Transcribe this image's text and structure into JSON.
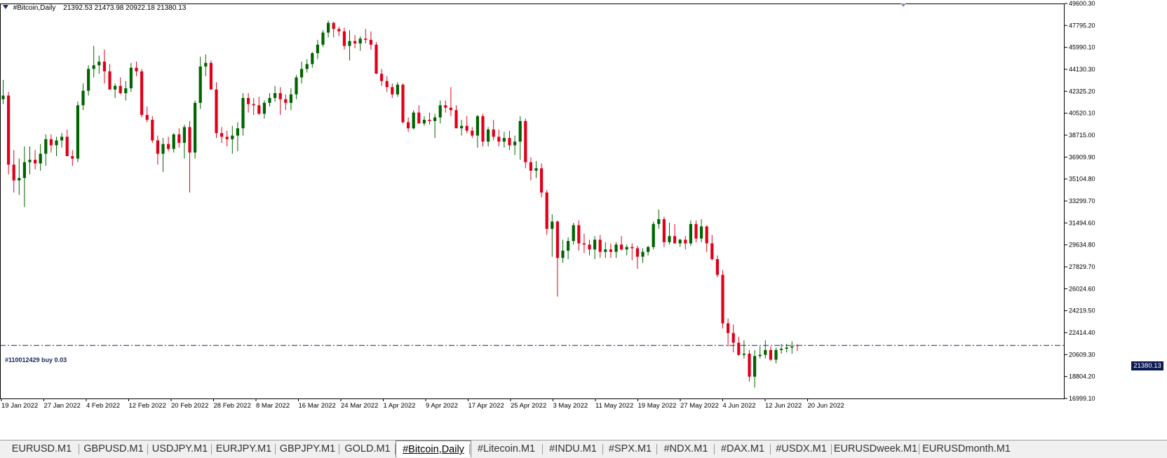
{
  "header": {
    "symbol": "#Bitcoin,Daily",
    "ohlc": "21392.53 21473.98 20922.18 21380.13"
  },
  "order_label": "#110012429 buy 0.03",
  "current_price": "21380.13",
  "colors": {
    "bull": "#006400",
    "bear": "#e0001a",
    "order_line": "#14285a",
    "price_tag": "#0a1a52"
  },
  "tabs": [
    {
      "label": "EURUSD.M1"
    },
    {
      "label": "GBPUSD.M1"
    },
    {
      "label": "USDJPY.M1"
    },
    {
      "label": "EURJPY.M1"
    },
    {
      "label": "GBPJPY.M1"
    },
    {
      "label": "GOLD.M1"
    },
    {
      "label": "#Bitcoin,Daily",
      "active": true
    },
    {
      "label": "#Litecoin.M1"
    },
    {
      "label": "#INDU.M1"
    },
    {
      "label": "#SPX.M1"
    },
    {
      "label": "#NDX.M1"
    },
    {
      "label": "#DAX.M1"
    },
    {
      "label": "#USDX.M1"
    },
    {
      "label": "EURUSDweek.M1"
    },
    {
      "label": "EURUSDmonth.M1"
    }
  ],
  "chart_data": {
    "type": "candlestick",
    "ylim": [
      16999.1,
      49600.3
    ],
    "y_ticks": [
      "49600.30",
      "47795.20",
      "45990.10",
      "44130.30",
      "42325.20",
      "40520.10",
      "38715.00",
      "36909.90",
      "35104.80",
      "33299.70",
      "31494.60",
      "29634.80",
      "27829.70",
      "26024.60",
      "24219.50",
      "22414.40",
      "20609.30",
      "18804.20",
      "16999.10"
    ],
    "x_labels": [
      "19 Jan 2022",
      "27 Jan 2022",
      "4 Feb 2022",
      "12 Feb 2022",
      "20 Feb 2022",
      "28 Feb 2022",
      "8 Mar 2022",
      "16 Mar 2022",
      "24 Mar 2022",
      "1 Apr 2022",
      "9 Apr 2022",
      "17 Apr 2022",
      "25 Apr 2022",
      "3 May 2022",
      "11 May 2022",
      "19 May 2022",
      "27 May 2022",
      "4 Jun 2022",
      "12 Jun 2022",
      "20 Jun 2022"
    ],
    "current_price": 21380.13,
    "series": [
      {
        "name": "#Bitcoin,Daily",
        "candles": [
          [
            41700,
            43300,
            41300,
            42000
          ],
          [
            42000,
            42300,
            35500,
            36300
          ],
          [
            36300,
            37500,
            34000,
            35000
          ],
          [
            35000,
            36800,
            33800,
            35200
          ],
          [
            35200,
            37800,
            32800,
            36500
          ],
          [
            36500,
            37800,
            35500,
            36700
          ],
          [
            36700,
            37500,
            35900,
            36400
          ],
          [
            36400,
            38000,
            35800,
            37200
          ],
          [
            37200,
            38800,
            36200,
            38400
          ],
          [
            38400,
            38800,
            37300,
            37900
          ],
          [
            37900,
            38600,
            37000,
            38300
          ],
          [
            38300,
            38900,
            37700,
            38600
          ],
          [
            38600,
            39200,
            37200,
            37000
          ],
          [
            37000,
            37500,
            36200,
            36800
          ],
          [
            36800,
            41500,
            36500,
            41200
          ],
          [
            41200,
            43000,
            40800,
            42400
          ],
          [
            42400,
            44500,
            42000,
            44200
          ],
          [
            44200,
            46100,
            43500,
            44500
          ],
          [
            44500,
            45300,
            43800,
            44800
          ],
          [
            44800,
            45800,
            43000,
            44000
          ],
          [
            44000,
            44600,
            42600,
            42500
          ],
          [
            42500,
            43000,
            41800,
            42800
          ],
          [
            42800,
            43500,
            42100,
            42200
          ],
          [
            42200,
            43200,
            41600,
            42600
          ],
          [
            42600,
            44700,
            42300,
            44300
          ],
          [
            44300,
            44800,
            43600,
            44000
          ],
          [
            44000,
            44200,
            40200,
            40400
          ],
          [
            40400,
            41100,
            39800,
            40000
          ],
          [
            40000,
            40300,
            38100,
            38300
          ],
          [
            38300,
            38700,
            36300,
            37200
          ],
          [
            37200,
            38500,
            35700,
            38000
          ],
          [
            38000,
            38600,
            37400,
            37600
          ],
          [
            37600,
            38900,
            37300,
            38800
          ],
          [
            38800,
            39300,
            37700,
            38100
          ],
          [
            38100,
            39600,
            36800,
            39400
          ],
          [
            39400,
            39900,
            34000,
            37300
          ],
          [
            37300,
            41600,
            36800,
            41400
          ],
          [
            41400,
            45200,
            40900,
            44400
          ],
          [
            44400,
            45400,
            43600,
            44700
          ],
          [
            44700,
            44900,
            42600,
            42500
          ],
          [
            42500,
            43100,
            38500,
            38900
          ],
          [
            38900,
            39400,
            38100,
            38600
          ],
          [
            38600,
            39100,
            37800,
            38400
          ],
          [
            38400,
            39500,
            37200,
            38700
          ],
          [
            38700,
            39800,
            37400,
            39300
          ],
          [
            39300,
            42200,
            38700,
            41800
          ],
          [
            41800,
            42200,
            40600,
            41300
          ],
          [
            41300,
            41800,
            40400,
            41200
          ],
          [
            41200,
            41900,
            40400,
            40500
          ],
          [
            40500,
            41600,
            40100,
            41400
          ],
          [
            41400,
            42200,
            41100,
            41800
          ],
          [
            41800,
            42800,
            41500,
            42200
          ],
          [
            42200,
            42700,
            40400,
            41700
          ],
          [
            41700,
            42100,
            40800,
            41400
          ],
          [
            41400,
            42600,
            40800,
            42100
          ],
          [
            42100,
            43700,
            41700,
            43500
          ],
          [
            43500,
            44800,
            43000,
            44200
          ],
          [
            44200,
            45000,
            43900,
            44600
          ],
          [
            44600,
            45600,
            44300,
            45500
          ],
          [
            45500,
            46600,
            45000,
            46200
          ],
          [
            46200,
            47400,
            46000,
            47200
          ],
          [
            47200,
            48200,
            46800,
            48000
          ],
          [
            48000,
            48100,
            46800,
            47500
          ],
          [
            47500,
            47700,
            46900,
            47300
          ],
          [
            47300,
            47600,
            45800,
            46100
          ],
          [
            46100,
            47400,
            44900,
            46500
          ],
          [
            46500,
            47000,
            45900,
            46300
          ],
          [
            46300,
            46900,
            45700,
            46700
          ],
          [
            46700,
            47500,
            46300,
            46600
          ],
          [
            46600,
            47300,
            45800,
            46200
          ],
          [
            46200,
            46400,
            43900,
            43800
          ],
          [
            43800,
            44200,
            42800,
            43200
          ],
          [
            43200,
            43600,
            42300,
            42700
          ],
          [
            42700,
            43000,
            41800,
            42100
          ],
          [
            42100,
            43100,
            41900,
            42900
          ],
          [
            42900,
            43000,
            39700,
            39800
          ],
          [
            39800,
            40200,
            39000,
            39300
          ],
          [
            39300,
            40800,
            39200,
            40600
          ],
          [
            40600,
            41200,
            39800,
            39700
          ],
          [
            39700,
            40300,
            39500,
            40000
          ],
          [
            40000,
            40600,
            39600,
            39900
          ],
          [
            39900,
            40500,
            38500,
            40200
          ],
          [
            40200,
            41600,
            39700,
            41200
          ],
          [
            41200,
            41600,
            40600,
            41000
          ],
          [
            41000,
            42700,
            40300,
            40800
          ],
          [
            40800,
            41200,
            39400,
            39300
          ],
          [
            39300,
            40000,
            38700,
            39500
          ],
          [
            39500,
            40300,
            38900,
            39100
          ],
          [
            39100,
            39400,
            38500,
            38700
          ],
          [
            38700,
            40400,
            37700,
            40300
          ],
          [
            40300,
            40500,
            37800,
            38200
          ],
          [
            38200,
            39400,
            37800,
            39200
          ],
          [
            39200,
            40000,
            38300,
            38600
          ],
          [
            38600,
            39200,
            37800,
            38200
          ],
          [
            38200,
            39000,
            37700,
            38500
          ],
          [
            38500,
            39100,
            37500,
            37900
          ],
          [
            37900,
            38700,
            37100,
            38200
          ],
          [
            38200,
            40300,
            36700,
            39900
          ],
          [
            39900,
            40100,
            36000,
            36500
          ],
          [
            36500,
            36900,
            35000,
            35800
          ],
          [
            35800,
            36600,
            35200,
            36000
          ],
          [
            36000,
            36400,
            33600,
            34000
          ],
          [
            34000,
            34200,
            30500,
            31000
          ],
          [
            31000,
            32200,
            28700,
            31600
          ],
          [
            31600,
            31700,
            25400,
            28600
          ],
          [
            28600,
            30100,
            28200,
            29200
          ],
          [
            29200,
            30300,
            28500,
            30000
          ],
          [
            30000,
            31500,
            29700,
            31300
          ],
          [
            31300,
            31700,
            29200,
            29800
          ],
          [
            29800,
            30600,
            29000,
            29700
          ],
          [
            29700,
            30100,
            28800,
            29300
          ],
          [
            29300,
            30400,
            28500,
            30100
          ],
          [
            30100,
            30500,
            28600,
            29100
          ],
          [
            29100,
            29900,
            28600,
            29300
          ],
          [
            29300,
            29800,
            28600,
            29100
          ],
          [
            29100,
            29900,
            28600,
            29700
          ],
          [
            29700,
            30400,
            29200,
            29300
          ],
          [
            29300,
            29700,
            28800,
            29500
          ],
          [
            29500,
            29800,
            28400,
            29400
          ],
          [
            29400,
            29600,
            27700,
            28700
          ],
          [
            28700,
            29400,
            28200,
            29100
          ],
          [
            29100,
            29600,
            28800,
            29500
          ],
          [
            29500,
            31600,
            29300,
            31400
          ],
          [
            31400,
            32600,
            31000,
            31800
          ],
          [
            31800,
            32000,
            29500,
            29900
          ],
          [
            29900,
            31500,
            29700,
            30400
          ],
          [
            30400,
            31400,
            29800,
            29800
          ],
          [
            29800,
            30200,
            29500,
            30100
          ],
          [
            30100,
            30400,
            29300,
            29800
          ],
          [
            29800,
            31700,
            29600,
            31400
          ],
          [
            31400,
            31700,
            29900,
            30200
          ],
          [
            30200,
            31800,
            29900,
            31200
          ],
          [
            31200,
            31300,
            29100,
            29800
          ],
          [
            29800,
            30500,
            28400,
            28500
          ],
          [
            28500,
            28800,
            27000,
            27200
          ],
          [
            27200,
            27600,
            22800,
            23200
          ],
          [
            23200,
            23600,
            21300,
            22400
          ],
          [
            22400,
            23100,
            20800,
            21600
          ],
          [
            21600,
            22100,
            20500,
            20600
          ],
          [
            20600,
            21800,
            20300,
            20700
          ],
          [
            20700,
            21000,
            18400,
            18800
          ],
          [
            18800,
            21000,
            17900,
            20500
          ],
          [
            20500,
            21300,
            20300,
            20600
          ],
          [
            20600,
            21800,
            20300,
            21000
          ],
          [
            21000,
            21300,
            20100,
            20200
          ],
          [
            20200,
            21200,
            19900,
            21000
          ],
          [
            21000,
            21500,
            20700,
            21100
          ],
          [
            21100,
            21500,
            20800,
            21200
          ],
          [
            21200,
            21700,
            20700,
            21300
          ],
          [
            21392.53,
            21473.98,
            20922.18,
            21380.13
          ]
        ]
      }
    ]
  }
}
